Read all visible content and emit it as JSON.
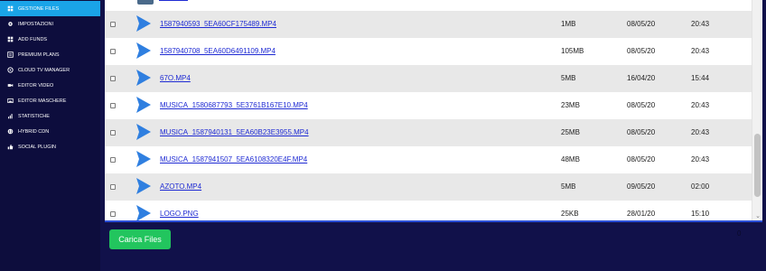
{
  "sidebar": {
    "items": [
      {
        "label": "GESTIONE FILES",
        "icon": "grid-icon",
        "active": true
      },
      {
        "label": "IMPOSTAZIONI",
        "icon": "gear-icon",
        "active": false
      },
      {
        "label": "ADD FUNDS",
        "icon": "grid-icon",
        "active": false
      },
      {
        "label": "PREMIUM PLANS",
        "icon": "list-icon",
        "active": false
      },
      {
        "label": "CLOUD TV MANAGER",
        "icon": "circle-icon",
        "active": false
      },
      {
        "label": "EDITOR VIDEO",
        "icon": "video-icon",
        "active": false
      },
      {
        "label": "EDITOR MASCHERE",
        "icon": "image-icon",
        "active": false
      },
      {
        "label": "STATISTICHE",
        "icon": "chart-icon",
        "active": false
      },
      {
        "label": "HYBRID CDN",
        "icon": "globe-icon",
        "active": false
      },
      {
        "label": "SOCIAL PLUGIN",
        "icon": "thumb-icon",
        "active": false
      }
    ]
  },
  "files": [
    {
      "name": "1587940593_5EA60CF175489.MP4",
      "size": "1MB",
      "date": "08/05/20",
      "time": "20:43"
    },
    {
      "name": "1587940708_5EA60D6491109.MP4",
      "size": "105MB",
      "date": "08/05/20",
      "time": "20:43"
    },
    {
      "name": "67O.MP4",
      "size": "5MB",
      "date": "16/04/20",
      "time": "15:44"
    },
    {
      "name": "MUSICA_1580687793_5E3761B167E10.MP4",
      "size": "23MB",
      "date": "08/05/20",
      "time": "20:43"
    },
    {
      "name": "MUSICA_1587940131_5EA60B23E3955.MP4",
      "size": "25MB",
      "date": "08/05/20",
      "time": "20:43"
    },
    {
      "name": "MUSICA_1587941507_5EA6108320E4F.MP4",
      "size": "48MB",
      "date": "08/05/20",
      "time": "20:43"
    },
    {
      "name": "AZOTO.MP4",
      "size": "5MB",
      "date": "09/05/20",
      "time": "02:00"
    },
    {
      "name": "LOGO.PNG",
      "size": "25KB",
      "date": "28/01/20",
      "time": "15:10"
    }
  ],
  "upload_button": "Carica Files",
  "corner_mark": "0",
  "colors": {
    "sidebar_bg": "#0d0d3d",
    "page_bg": "#11114a",
    "active": "#1aa4e8",
    "play_icon": "#2f7fe0",
    "link": "#1f2bd3",
    "upload_button": "#22c55e"
  }
}
